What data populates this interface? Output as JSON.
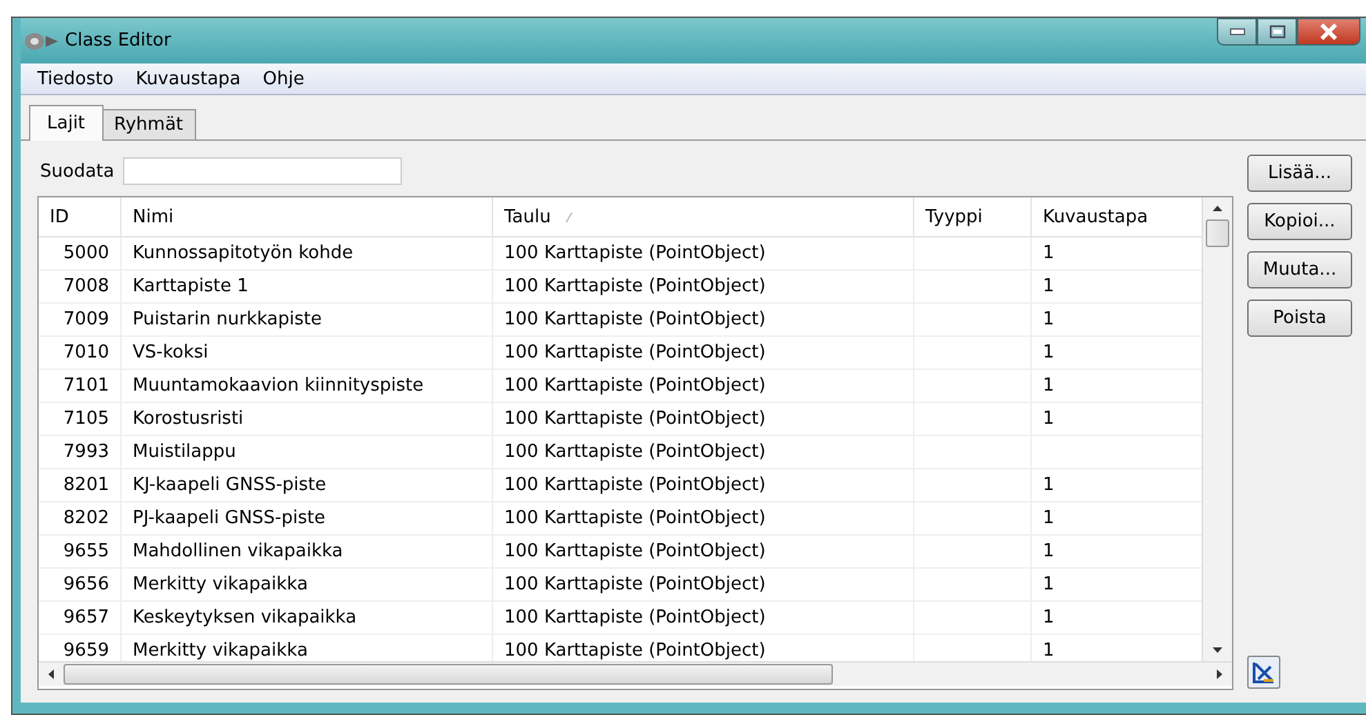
{
  "window": {
    "title": "Class Editor"
  },
  "menu": [
    "Tiedosto",
    "Kuvaustapa",
    "Ohje"
  ],
  "tabs": [
    {
      "label": "Lajit",
      "selected": true
    },
    {
      "label": "Ryhmät",
      "selected": false
    }
  ],
  "filter": {
    "label": "Suodata"
  },
  "table": {
    "columns": [
      {
        "label": "ID",
        "sorted": false
      },
      {
        "label": "Nimi",
        "sorted": false
      },
      {
        "label": "Taulu",
        "sorted": true
      },
      {
        "label": "Tyyppi",
        "sorted": false
      },
      {
        "label": "Kuvaustapa",
        "sorted": false
      }
    ],
    "rows": [
      [
        "5000",
        "Kunnossapitotyön kohde",
        "100 Karttapiste (PointObject)",
        "",
        "1"
      ],
      [
        "7008",
        "Karttapiste 1",
        "100 Karttapiste (PointObject)",
        "",
        "1"
      ],
      [
        "7009",
        "Puistarin nurkkapiste",
        "100 Karttapiste (PointObject)",
        "",
        "1"
      ],
      [
        "7010",
        "VS-koksi",
        "100 Karttapiste (PointObject)",
        "",
        "1"
      ],
      [
        "7101",
        "Muuntamokaavion kiinnityspiste",
        "100 Karttapiste (PointObject)",
        "",
        "1"
      ],
      [
        "7105",
        "Korostusristi",
        "100 Karttapiste (PointObject)",
        "",
        "1"
      ],
      [
        "7993",
        "Muistilappu",
        "100 Karttapiste (PointObject)",
        "",
        ""
      ],
      [
        "8201",
        "KJ-kaapeli GNSS-piste",
        "100 Karttapiste (PointObject)",
        "",
        "1"
      ],
      [
        "8202",
        "PJ-kaapeli GNSS-piste",
        "100 Karttapiste (PointObject)",
        "",
        "1"
      ],
      [
        "9655",
        "Mahdollinen vikapaikka",
        "100 Karttapiste (PointObject)",
        "",
        "1"
      ],
      [
        "9656",
        "Merkitty vikapaikka",
        "100 Karttapiste (PointObject)",
        "",
        "1"
      ],
      [
        "9657",
        "Keskeytyksen vikapaikka",
        "100 Karttapiste (PointObject)",
        "",
        "1"
      ],
      [
        "9659",
        "Merkitty vikapaikka",
        "100 Karttapiste (PointObject)",
        "",
        "1"
      ]
    ]
  },
  "buttons": [
    "Lisää...",
    "Kopioi...",
    "Muuta...",
    "Poista"
  ]
}
